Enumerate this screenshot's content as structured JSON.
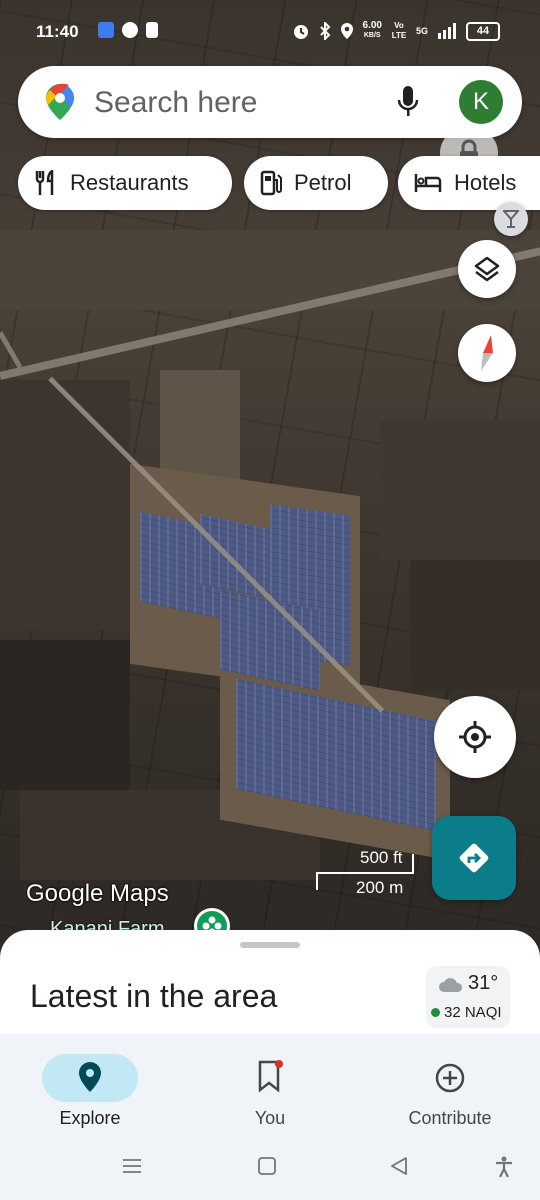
{
  "status_bar": {
    "time": "11:40",
    "network_speed_value": "6.00",
    "network_speed_unit": "KB/S",
    "carrier": "Vo LTE",
    "network_type": "5G",
    "battery": "44"
  },
  "search": {
    "placeholder": "Search here",
    "avatar_letter": "K"
  },
  "chips": [
    {
      "label": "Restaurants",
      "icon": "restaurant-icon"
    },
    {
      "label": "Petrol",
      "icon": "gas-station-icon"
    },
    {
      "label": "Hotels",
      "icon": "hotel-icon"
    }
  ],
  "map": {
    "logo_text": "Google Maps",
    "place_label": "Kanani Farm",
    "scale_imperial": "500 ft",
    "scale_metric": "200 m"
  },
  "sheet": {
    "title": "Latest in the area",
    "temperature": "31°",
    "aqi": "32 NAQI",
    "weather_icon": "cloud-icon"
  },
  "bottom_nav": {
    "items": [
      {
        "label": "Explore",
        "icon": "explore-pin-icon",
        "active": true
      },
      {
        "label": "You",
        "icon": "bookmark-icon",
        "active": false
      },
      {
        "label": "Contribute",
        "icon": "add-circle-icon",
        "active": false
      }
    ]
  },
  "colors": {
    "directions_button": "#0b7d8a",
    "active_nav_pill": "#c2e7f5",
    "avatar": "#2e7d32"
  }
}
